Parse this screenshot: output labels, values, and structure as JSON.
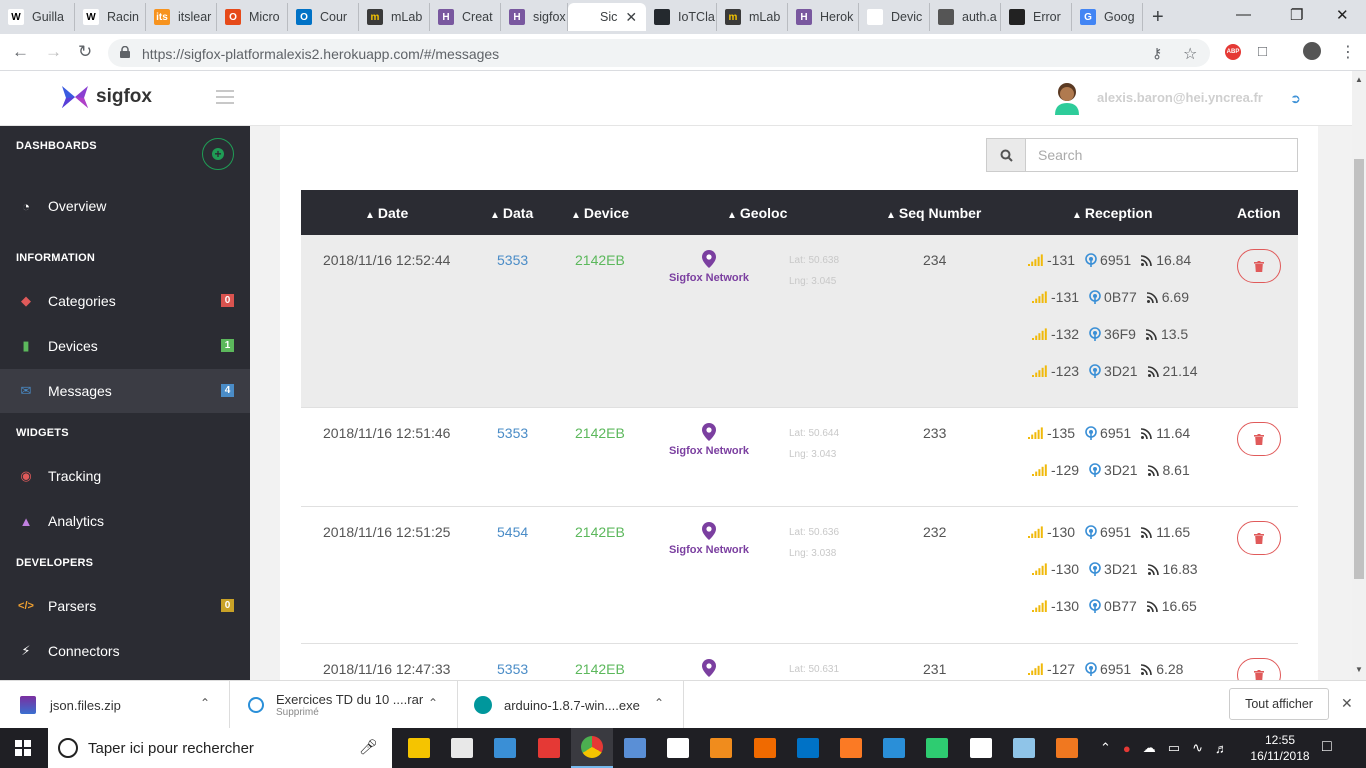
{
  "browser": {
    "tabs": [
      {
        "title": "Guilla",
        "fav": "W",
        "color": "#ffffff",
        "text": "#000000"
      },
      {
        "title": "Racin",
        "fav": "W",
        "color": "#ffffff",
        "text": "#000000"
      },
      {
        "title": "itslear",
        "fav": "its",
        "color": "#f7931e",
        "text": "#ffffff"
      },
      {
        "title": "Micro",
        "fav": "O",
        "color": "#e64a19",
        "text": "#ffffff"
      },
      {
        "title": "Cour",
        "fav": "O",
        "color": "#0072c6",
        "text": "#ffffff"
      },
      {
        "title": "mLab",
        "fav": "m",
        "color": "#3a3a3a",
        "text": "#f5c400"
      },
      {
        "title": "Creat",
        "fav": "H",
        "color": "#79589f",
        "text": "#ffffff"
      },
      {
        "title": "sigfox",
        "fav": "H",
        "color": "#79589f",
        "text": "#ffffff"
      },
      {
        "title": "Sic",
        "fav": "",
        "color": "#ffffff",
        "text": "#000000",
        "active": true
      },
      {
        "title": "IoTCla",
        "fav": "",
        "color": "#24292e",
        "text": "#ffffff"
      },
      {
        "title": "mLab",
        "fav": "m",
        "color": "#3a3a3a",
        "text": "#f5c400"
      },
      {
        "title": "Herok",
        "fav": "H",
        "color": "#79589f",
        "text": "#ffffff"
      },
      {
        "title": "Devic",
        "fav": "",
        "color": "#ffffff",
        "text": "#000000"
      },
      {
        "title": "auth.a",
        "fav": "",
        "color": "#555555",
        "text": "#ffffff"
      },
      {
        "title": "Error",
        "fav": "",
        "color": "#222222",
        "text": "#ffffff"
      },
      {
        "title": "Goog",
        "fav": "G",
        "color": "#4285f4",
        "text": "#ffffff"
      }
    ],
    "url": "https://sigfox-platformalexis2.herokuapp.com/#/messages",
    "abp_label": "ABP"
  },
  "header": {
    "brand": "sigfox",
    "user_email": "alexis.baron@hei.yncrea.fr"
  },
  "sidebar": {
    "sections": {
      "dashboards": "DASHBOARDS",
      "information": "INFORMATION",
      "widgets": "WIDGETS",
      "developers": "DEVELOPERS"
    },
    "items": {
      "overview": {
        "label": "Overview"
      },
      "categories": {
        "label": "Categories",
        "badge": "0"
      },
      "devices": {
        "label": "Devices",
        "badge": "1"
      },
      "messages": {
        "label": "Messages",
        "badge": "4"
      },
      "tracking": {
        "label": "Tracking"
      },
      "analytics": {
        "label": "Analytics"
      },
      "parsers": {
        "label": "Parsers",
        "badge": "0"
      },
      "connectors": {
        "label": "Connectors"
      }
    }
  },
  "search": {
    "placeholder": "Search"
  },
  "table": {
    "headers": {
      "date": "Date",
      "data": "Data",
      "device": "Device",
      "geoloc": "Geoloc",
      "seq": "Seq Number",
      "reception": "Reception",
      "action": "Action"
    },
    "rows": [
      {
        "date": "2018/11/16 12:52:44",
        "data": "5353",
        "device": "2142EB",
        "geo_name": "Sigfox Network",
        "lat": "Lat: 50.638",
        "lng": "Lng: 3.045",
        "seq": "234",
        "reception": [
          {
            "rssi": "-131",
            "gw": "6951",
            "snr": "16.84"
          },
          {
            "rssi": "-131",
            "gw": "0B77",
            "snr": "6.69"
          },
          {
            "rssi": "-132",
            "gw": "36F9",
            "snr": "13.5"
          },
          {
            "rssi": "-123",
            "gw": "3D21",
            "snr": "21.14"
          }
        ]
      },
      {
        "date": "2018/11/16 12:51:46",
        "data": "5353",
        "device": "2142EB",
        "geo_name": "Sigfox Network",
        "lat": "Lat: 50.644",
        "lng": "Lng: 3.043",
        "seq": "233",
        "reception": [
          {
            "rssi": "-135",
            "gw": "6951",
            "snr": "11.64"
          },
          {
            "rssi": "-129",
            "gw": "3D21",
            "snr": "8.61"
          }
        ]
      },
      {
        "date": "2018/11/16 12:51:25",
        "data": "5454",
        "device": "2142EB",
        "geo_name": "Sigfox Network",
        "lat": "Lat: 50.636",
        "lng": "Lng: 3.038",
        "seq": "232",
        "reception": [
          {
            "rssi": "-130",
            "gw": "6951",
            "snr": "11.65"
          },
          {
            "rssi": "-130",
            "gw": "3D21",
            "snr": "16.83"
          },
          {
            "rssi": "-130",
            "gw": "0B77",
            "snr": "16.65"
          }
        ]
      },
      {
        "date": "2018/11/16 12:47:33",
        "data": "5353",
        "device": "2142EB",
        "geo_name": "",
        "lat": "Lat: 50.631",
        "lng": "",
        "seq": "231",
        "reception": [
          {
            "rssi": "-127",
            "gw": "6951",
            "snr": "6.28"
          }
        ]
      }
    ]
  },
  "downloads": {
    "items": [
      {
        "name": "json.files.zip",
        "sub": ""
      },
      {
        "name": "Exercices TD du 10 ....rar",
        "sub": "Supprimé"
      },
      {
        "name": "arduino-1.8.7-win....exe",
        "sub": ""
      }
    ],
    "show_all": "Tout afficher"
  },
  "taskbar": {
    "search_placeholder": "Taper ici pour rechercher",
    "time": "12:55",
    "date": "16/11/2018"
  },
  "colors": {
    "sidebar_bg": "#2b2c33",
    "table_header_bg": "#2b2c33",
    "data_link": "#4a8cc7",
    "device_green": "#5cb85c",
    "geo_purple": "#7b3fa0",
    "delete_red": "#e05a5a",
    "signal_yellow": "#f0b90b",
    "gateway_blue": "#3a8fd6"
  }
}
